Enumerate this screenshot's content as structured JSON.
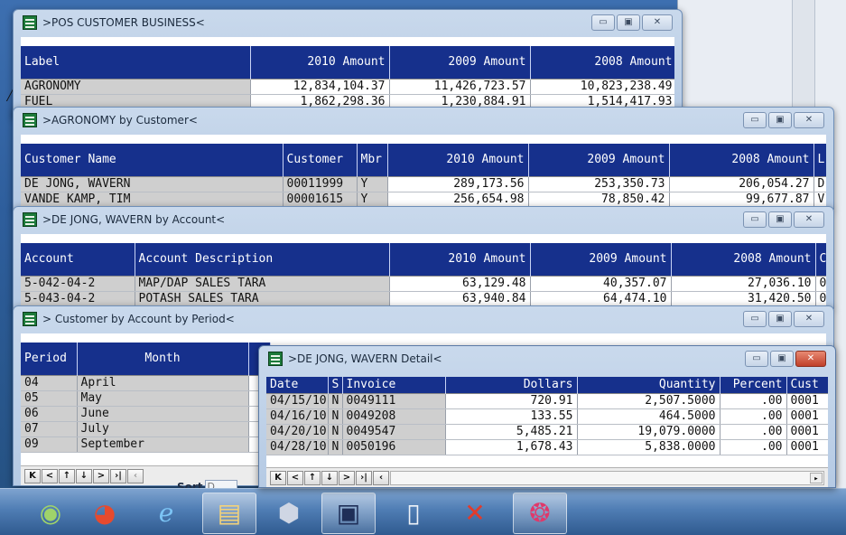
{
  "window_controls": {
    "minimize": "▭",
    "maximize": "▣",
    "close": "✕"
  },
  "nav_buttons": [
    "K",
    "<",
    "↑",
    "↓",
    ">",
    "›|"
  ],
  "win1": {
    "title": ">POS CUSTOMER BUSINESS<",
    "headers": [
      "Label",
      "2010 Amount",
      "2009 Amount",
      "2008 Amount"
    ],
    "rows": [
      [
        "AGRONOMY",
        "12,834,104.37",
        "11,426,723.57",
        "10,823,238.49"
      ],
      [
        "FUEL",
        "1,862,298.36",
        "1,230,884.91",
        "1,514,417.93"
      ]
    ]
  },
  "win2": {
    "title": ">AGRONOMY by Customer<",
    "headers": [
      "Customer Name",
      "Customer",
      "Mbr",
      "2010 Amount",
      "2009 Amount",
      "2008 Amount",
      "L"
    ],
    "rows": [
      [
        "DE JONG, WAVERN",
        "00011999",
        "Y",
        "289,173.56",
        "253,350.73",
        "206,054.27",
        "D"
      ],
      [
        "VANDE KAMP, TIM",
        "00001615",
        "Y",
        "256,654.98",
        "78,850.42",
        "99,677.87",
        "V"
      ]
    ]
  },
  "win3": {
    "title": ">DE JONG, WAVERN by Account<",
    "headers": [
      "Account",
      "Account Description",
      "2010 Amount",
      "2009 Amount",
      "2008 Amount",
      "C"
    ],
    "rows": [
      [
        "5-042-04-2",
        "MAP/DAP SALES TARA",
        "63,129.48",
        "40,357.07",
        "27,036.10",
        "0"
      ],
      [
        "5-043-04-2",
        "POTASH SALES TARA",
        "63,940.84",
        "64,474.10",
        "31,420.50",
        "0"
      ]
    ]
  },
  "win4": {
    "title": "> Customer by Account by Period<",
    "headers": [
      "Period",
      "Month"
    ],
    "rows": [
      [
        "04",
        "April"
      ],
      [
        "05",
        "May"
      ],
      [
        "06",
        "June"
      ],
      [
        "07",
        "July"
      ],
      [
        "09",
        "September"
      ]
    ],
    "sort_label": "Sort",
    "sort_value": "D"
  },
  "win5": {
    "title": ">DE JONG, WAVERN Detail<",
    "headers": [
      "Date",
      "S",
      "Invoice",
      "Dollars",
      "Quantity",
      "Percent",
      "Cust"
    ],
    "rows": [
      [
        "04/15/10",
        "N",
        "0049111",
        "720.91",
        "2,507.5000",
        ".00",
        "0001"
      ],
      [
        "04/16/10",
        "N",
        "0049208",
        "133.55",
        "464.5000",
        ".00",
        "0001"
      ],
      [
        "04/20/10",
        "N",
        "0049547",
        "5,485.21",
        "19,079.0000",
        ".00",
        "0001"
      ],
      [
        "04/28/10",
        "N",
        "0050196",
        "1,678.43",
        "5,838.0000",
        ".00",
        "0001"
      ]
    ]
  },
  "taskbar": {
    "items": [
      {
        "name": "start-orb",
        "glyph": "◉",
        "color": "#9fd36a"
      },
      {
        "name": "chrome",
        "glyph": "◕",
        "color": "#e64a2e"
      },
      {
        "name": "internet-explorer",
        "glyph": "ℯ",
        "color": "#7cc4f5"
      },
      {
        "name": "file-explorer",
        "glyph": "▤",
        "color": "#f3d27a"
      },
      {
        "name": "app-cube",
        "glyph": "⬢",
        "color": "#cfd6e4"
      },
      {
        "name": "remote-desktop",
        "glyph": "▣",
        "color": "#1f2f58"
      },
      {
        "name": "blank-window",
        "glyph": "▯",
        "color": "#eef2f8"
      },
      {
        "name": "x-app",
        "glyph": "✕",
        "color": "#e23b2b"
      },
      {
        "name": "paint-app",
        "glyph": "❂",
        "color": "#e0386a"
      }
    ]
  }
}
